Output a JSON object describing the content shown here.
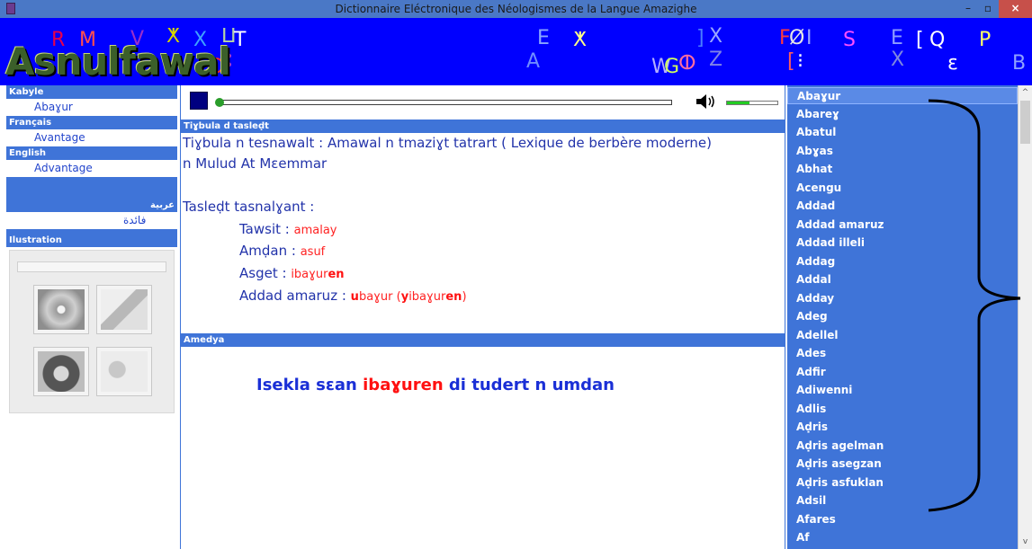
{
  "window": {
    "title": "Dictionnaire Eléctronique des Néologismes de la Langue Amazighe",
    "min_label": "–",
    "max_label": "▫",
    "close_label": "×"
  },
  "banner": {
    "logo_text": "Asnulfawal",
    "glyphs": [
      "R",
      "M",
      "V",
      "ⵅ",
      "X",
      "ⵡ",
      "T",
      "O",
      "ⵓ",
      "E",
      "A",
      "ⵅ",
      "W",
      "G",
      "ⵀ",
      "]",
      "X",
      "Z",
      "F",
      "Ø",
      "I",
      "[",
      "⁝",
      "S",
      "E",
      "X",
      "[",
      "Q",
      "ε",
      "P",
      "B"
    ]
  },
  "sidebar": {
    "sections": [
      {
        "label": "Kabyle",
        "value": "Abaɣur"
      },
      {
        "label": "Français",
        "value": "Avantage"
      },
      {
        "label": "English",
        "value": "Advantage"
      },
      {
        "label": "عربية",
        "value": "فائدة"
      }
    ],
    "illustration_label": "Ilustration"
  },
  "player": {
    "progress": 0.0,
    "volume": 0.45
  },
  "definition": {
    "header": "Tiɣbula d tasleḍt",
    "source_line1": "Tiɣbula n tesnawalt : Amawal n tmaziɣt tatrart ( Lexique de berbère moderne)",
    "source_line2": "n Mulud At Mɛemmar",
    "analysis_label": "Tasleḍt tasnalɣant :",
    "tawsit_label": "Tawsit :",
    "tawsit_value": "amalay",
    "amdan_label": "Amḍan :",
    "amdan_value": "asuf",
    "asget_label": "Asget :",
    "asget_value_root": "ibaɣur",
    "asget_value_suffix": "en",
    "addad_label": "Addad amaruz :",
    "addad_value_prefix": "u",
    "addad_value_root": "baɣur",
    "addad_paren_open": " (",
    "addad_paren_prefix": "y",
    "addad_paren_root": "ibaɣur",
    "addad_paren_suffix": "en",
    "addad_paren_close": ")"
  },
  "example": {
    "header": "Amedya",
    "before": "Isekla sɛan ",
    "highlight": "ibaɣuren",
    "after": " di tudert n umdan"
  },
  "wordlist": {
    "items": [
      "Abaɣur",
      "Abareɣ",
      "Abatul",
      "Abɣas",
      "Abhat",
      "Acengu",
      "Addad",
      "Addad amaruz",
      "Addad illeli",
      "Addag",
      "Addal",
      "Adday",
      "Adeg",
      "Adellel",
      "Ades",
      "Adfir",
      "Adiwenni",
      "Adlis",
      "Aḍris",
      "Aḍris agelman",
      "Aḍris asegzan",
      "Aḍris asfuklan",
      "Adsil",
      "Afares",
      "Af"
    ],
    "selected_index": 0,
    "scroll_up": "^",
    "scroll_down": "v"
  }
}
